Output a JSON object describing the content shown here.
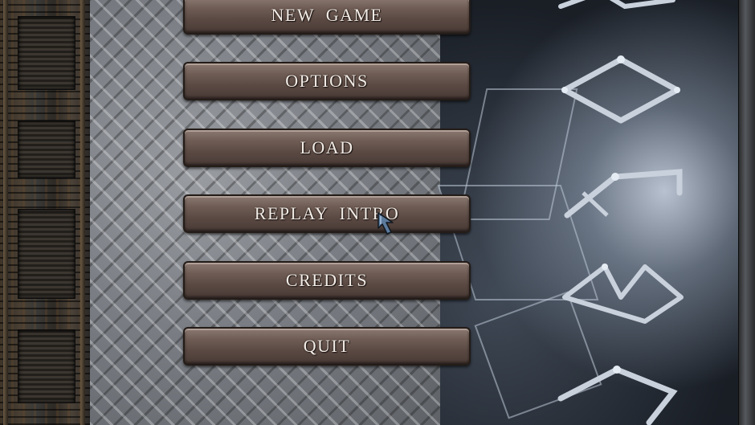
{
  "menu": {
    "buttons": [
      {
        "id": "new-game",
        "label": "NEW  GAME"
      },
      {
        "id": "options",
        "label": "OPTIONS"
      },
      {
        "id": "load",
        "label": "LOAD"
      },
      {
        "id": "replay-intro",
        "label": "REPLAY  INTRO"
      },
      {
        "id": "credits",
        "label": "CREDITS"
      },
      {
        "id": "quit",
        "label": "QUIT"
      }
    ]
  },
  "icons": {
    "cursor": "arrow-cursor-icon",
    "runes": [
      "rune-glyph-icon",
      "rune-glyph-icon",
      "rune-glyph-icon",
      "rune-glyph-icon",
      "rune-glyph-icon",
      "rune-glyph-icon"
    ]
  },
  "colors": {
    "button_fill": "#6f5d55",
    "button_text": "#f2ece6",
    "plate_metal": "#7d8186",
    "rune_steel": "#c9d1dc"
  }
}
